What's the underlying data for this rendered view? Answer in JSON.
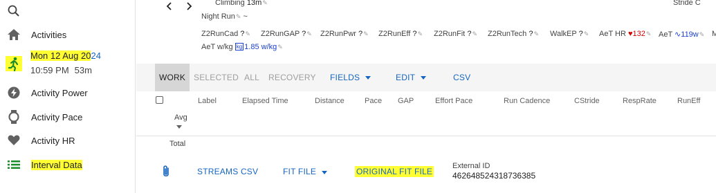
{
  "sidebar": {
    "items": [
      {
        "label": "Activities",
        "icon": "home-icon"
      },
      {
        "label": "Activity Power",
        "icon": "lightning-icon"
      },
      {
        "label": "Activity Pace",
        "icon": "watch-icon"
      },
      {
        "label": "Activity HR",
        "icon": "heart-icon"
      },
      {
        "label": "Interval Data",
        "icon": "list-icon"
      }
    ],
    "current_activity": {
      "date_highlighted": "Mon 12 Aug 20",
      "date_tail": "24",
      "time": "10:59 PM",
      "duration": "53m"
    },
    "highlight_color": "#ffff33"
  },
  "header": {
    "climbing_label": "Climbing",
    "climbing_value": "13m",
    "stride_label": "Stride C",
    "activity_name": "Night Run",
    "activity_name_suffix": "~"
  },
  "fields": [
    {
      "label": "Z2RunCad",
      "value": "?"
    },
    {
      "label": "Z2RunGAP",
      "value": "?"
    },
    {
      "label": "Z2RunPwr",
      "value": "?"
    },
    {
      "label": "Z2RunEff",
      "value": "?"
    },
    {
      "label": "Z2RunFit",
      "value": "?"
    },
    {
      "label": "Z2RunTech",
      "value": "?"
    },
    {
      "label": "WalkEP",
      "value": "?"
    },
    {
      "label": "AeT HR",
      "value": "132"
    },
    {
      "label": "AeT",
      "value": "119w"
    },
    {
      "label": "M",
      "value": ""
    }
  ],
  "aet_wkg": {
    "label": "AeT w/kg",
    "value": "1.85 w/kg"
  },
  "toolbar": {
    "work": "WORK",
    "selected": "SELECTED",
    "all": "ALL",
    "recovery": "RECOVERY",
    "fields": "FIELDS",
    "edit": "EDIT",
    "csv": "CSV"
  },
  "table": {
    "columns": [
      "Label",
      "Elapsed Time",
      "Distance",
      "Pace",
      "GAP",
      "Effort Pace",
      "Run Cadence",
      "CStride",
      "RespRate",
      "RunEff"
    ],
    "avg_label": "Avg",
    "total_label": "Total"
  },
  "files": {
    "streams_csv": "STREAMS CSV",
    "fit_file": "FIT FILE",
    "original_fit_file": "ORIGINAL FIT FILE",
    "external_id_label": "External ID",
    "external_id_value": "462648524318736385"
  },
  "colors": {
    "accent": "#1565c0",
    "heart": "#d50000",
    "highlight": "#ffff33"
  }
}
